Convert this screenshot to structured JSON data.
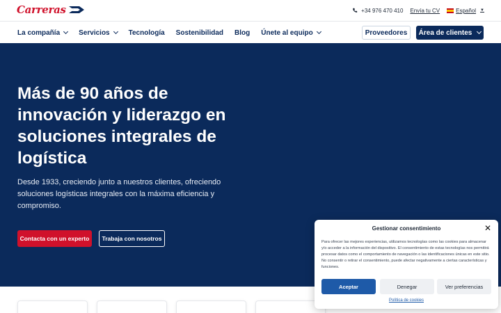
{
  "brand": {
    "name": "Carreras",
    "color": "#d0112b"
  },
  "topbar": {
    "phone": "+34 976 470 410",
    "cv_link": "Envía tu CV",
    "language": "Español"
  },
  "nav": {
    "items": [
      {
        "label": "La compañía",
        "has_dropdown": true
      },
      {
        "label": "Servicios",
        "has_dropdown": true
      },
      {
        "label": "Tecnología",
        "has_dropdown": false
      },
      {
        "label": "Sostenibilidad",
        "has_dropdown": false
      },
      {
        "label": "Blog",
        "has_dropdown": false
      },
      {
        "label": "Únete al equipo",
        "has_dropdown": true
      }
    ],
    "suppliers_button": "Proveedores",
    "clients_button": "Área de clientes"
  },
  "hero": {
    "title": "Más de 90 años de innovación y liderazgo en soluciones integrales de logística",
    "subtitle": "Desde 1933, creciendo junto a nuestros clientes, ofreciendo soluciones logísticas integrales con la máxima eficiencia y compromiso.",
    "cta_primary": "Contacta con un experto",
    "cta_secondary": "Trabaja con nosotros",
    "background": "#0b2a5b"
  },
  "consent": {
    "title": "Gestionar consentimiento",
    "body": "Para ofrecer las mejores experiencias, utilizamos tecnologías como las cookies para almacenar y/o acceder a la información del dispositivo. El consentimiento de estas tecnologías nos permitirá procesar datos como el comportamiento de navegación o las identificaciones únicas en este sitio. No consentir o retirar el consentimiento, puede afectar negativamente a ciertas características y funciones.",
    "accept": "Aceptar",
    "deny": "Denegar",
    "preferences": "Ver preferencias",
    "policy_link": "Política de cookies"
  }
}
